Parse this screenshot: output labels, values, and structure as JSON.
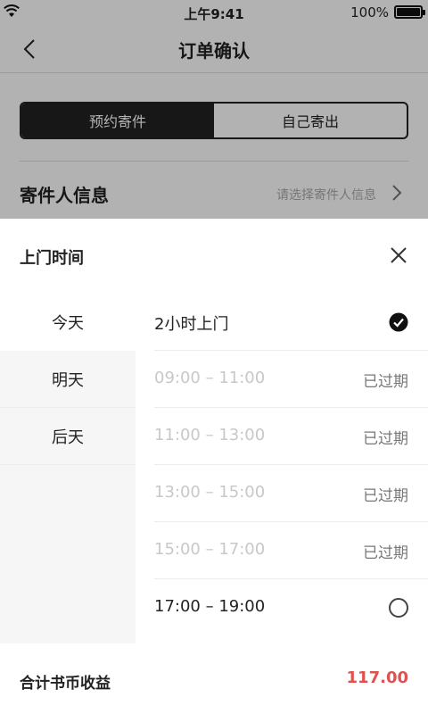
{
  "status_bar": {
    "time": "上午9:41",
    "battery": "100%"
  },
  "nav": {
    "title": "订单确认"
  },
  "segment": {
    "options": [
      "预约寄件",
      "自己寄出"
    ],
    "selected": 0
  },
  "sender": {
    "label": "寄件人信息",
    "placeholder": "请选择寄件人信息"
  },
  "sheet": {
    "title": "上门时间",
    "days": [
      "今天",
      "明天",
      "后天"
    ],
    "selected_day": 0,
    "slots": [
      {
        "time": "2小时上门",
        "state": "",
        "selected": true,
        "expired": false
      },
      {
        "time": "09:00 – 11:00",
        "state": "已过期",
        "selected": false,
        "expired": true
      },
      {
        "time": "11:00 – 13:00",
        "state": "已过期",
        "selected": false,
        "expired": true
      },
      {
        "time": "13:00 – 15:00",
        "state": "已过期",
        "selected": false,
        "expired": true
      },
      {
        "time": "15:00 – 17:00",
        "state": "已过期",
        "selected": false,
        "expired": true
      },
      {
        "time": "17:00 – 19:00",
        "state": "",
        "selected": false,
        "expired": false
      }
    ]
  },
  "footer": {
    "label": "合计书币收益",
    "amount": "117.00"
  },
  "colors": {
    "accent_red": "#e0524f",
    "dark": "#222222",
    "overlay": "rgba(0,0,0,0.30)"
  }
}
